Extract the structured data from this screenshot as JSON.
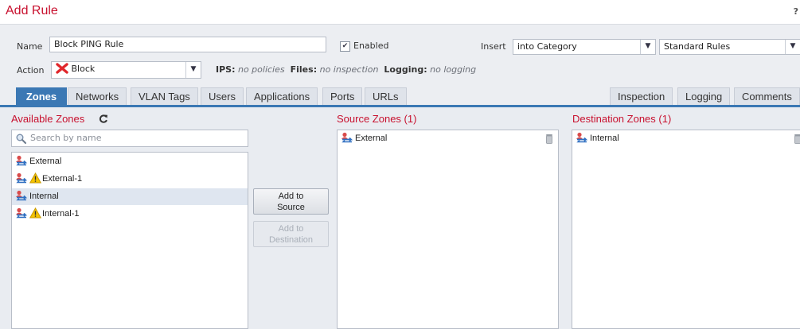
{
  "window": {
    "title": "Add Rule",
    "help_label": "?"
  },
  "form": {
    "name_label": "Name",
    "name_value": "Block PING Rule",
    "enabled_label": "Enabled",
    "enabled_checked": true,
    "insert_label": "Insert",
    "insert_value": "into Category",
    "category_value": "Standard Rules",
    "action_label": "Action",
    "action_value": "Block",
    "ips_label": "IPS:",
    "ips_value": "no policies",
    "files_label": "Files:",
    "files_value": "no inspection",
    "logging_label": "Logging:",
    "logging_value": "no logging"
  },
  "tabs_left": [
    "Zones",
    "Networks",
    "VLAN Tags",
    "Users",
    "Applications",
    "Ports",
    "URLs"
  ],
  "tabs_right": [
    "Inspection",
    "Logging",
    "Comments"
  ],
  "active_tab": "Zones",
  "available": {
    "title": "Available Zones",
    "search_placeholder": "Search by name",
    "items": [
      {
        "label": "External",
        "warning": false,
        "selected": false
      },
      {
        "label": "External-1",
        "warning": true,
        "selected": false
      },
      {
        "label": "Internal",
        "warning": false,
        "selected": true
      },
      {
        "label": "Internal-1",
        "warning": true,
        "selected": false
      }
    ]
  },
  "buttons": {
    "add_source_line1": "Add to",
    "add_source_line2": "Source",
    "add_dest_line1": "Add to",
    "add_dest_line2": "Destination"
  },
  "source": {
    "title": "Source Zones (1)",
    "items": [
      "External"
    ]
  },
  "destination": {
    "title": "Destination Zones (1)",
    "items": [
      "Internal"
    ]
  },
  "colors": {
    "accent": "#3b78b4",
    "title_red": "#c8102e",
    "block_red": "#e0262b"
  }
}
